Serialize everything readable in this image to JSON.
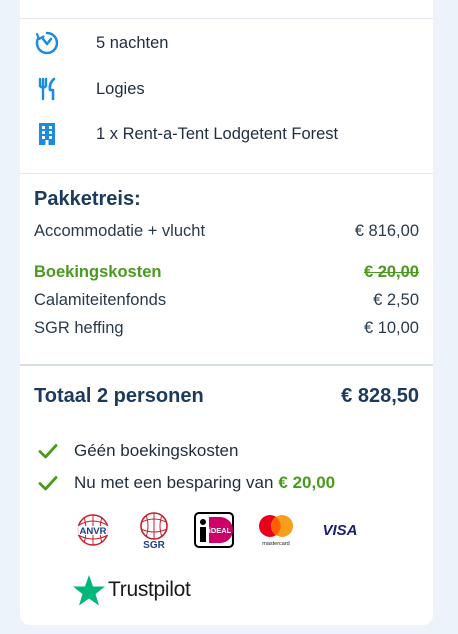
{
  "details": {
    "nights": "5 nachten",
    "board": "Logies",
    "room": "1 x Rent-a-Tent Lodgetent Forest"
  },
  "package": {
    "title": "Pakketreis:",
    "lines": [
      {
        "label": "Accommodatie + vlucht",
        "value": "€ 816,00"
      },
      {
        "label": "Boekingskosten",
        "value": "€ 20,00"
      },
      {
        "label": "Calamiteitenfonds",
        "value": "€ 2,50"
      },
      {
        "label": "SGR heffing",
        "value": "€ 10,00"
      }
    ]
  },
  "total": {
    "label": "Totaal 2 personen",
    "value": "€ 828,50"
  },
  "benefits": {
    "no_fees": "Géén boekingskosten",
    "saving_prefix": "Nu met een besparing van",
    "saving_value": "€ 20,00"
  },
  "logos": {
    "anvr": "ANVR",
    "sgr": "SGR",
    "ideal": "iDEAL",
    "mastercard": "mastercard",
    "visa": "VISA"
  },
  "trustpilot": "Trustpilot",
  "colors": {
    "accent_blue": "#1b8ce0",
    "heading_navy": "#1b3a5c",
    "green": "#4a9a1f"
  }
}
